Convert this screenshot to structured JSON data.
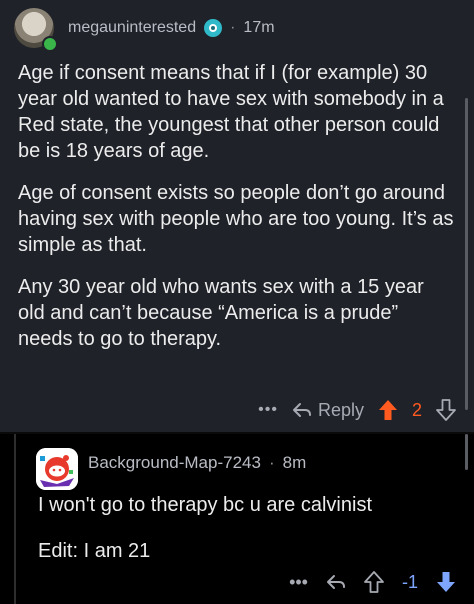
{
  "comments": [
    {
      "username": "megauninterested",
      "separator": "·",
      "time": "17m",
      "paragraphs": [
        "Age if consent means that if I (for example) 30 year old wanted to have sex with somebody in a Red state, the youngest that other person could be is 18 years of age.",
        "Age of consent exists so people don’t go around having sex with people who are too young. It’s as simple as that.",
        "Any 30 year old who wants sex with a 15 year old and can’t because “America is a prude” needs to go to therapy."
      ],
      "more_label": "•••",
      "reply_label": "Reply",
      "vote_count": "2",
      "vote_state": "upvoted"
    },
    {
      "username": "Background-Map-7243",
      "separator": "·",
      "time": "8m",
      "paragraphs": [
        "I won't go to therapy bc u are calvinist",
        "Edit: I am 21"
      ],
      "more_label": "•••",
      "vote_count": "-1"
    }
  ],
  "colors": {
    "upvote_accent": "#ff5a1f",
    "score_accent": "#7ea6ff",
    "online": "#39b54a"
  }
}
